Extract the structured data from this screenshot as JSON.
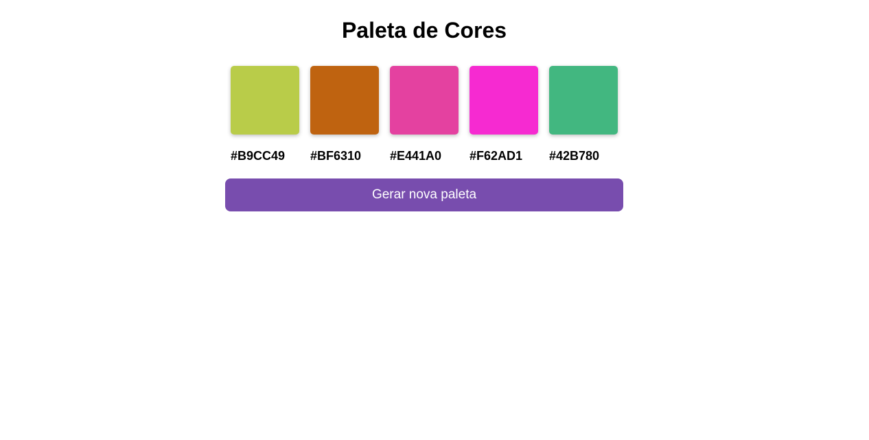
{
  "page": {
    "title": "Paleta de Cores"
  },
  "palette": {
    "colors": [
      {
        "hex": "#B9CC49"
      },
      {
        "hex": "#BF6310"
      },
      {
        "hex": "#E441A0"
      },
      {
        "hex": "#F62AD1"
      },
      {
        "hex": "#42B780"
      }
    ]
  },
  "actions": {
    "generate_label": "Gerar nova paleta",
    "button_color": "#784DAE"
  }
}
